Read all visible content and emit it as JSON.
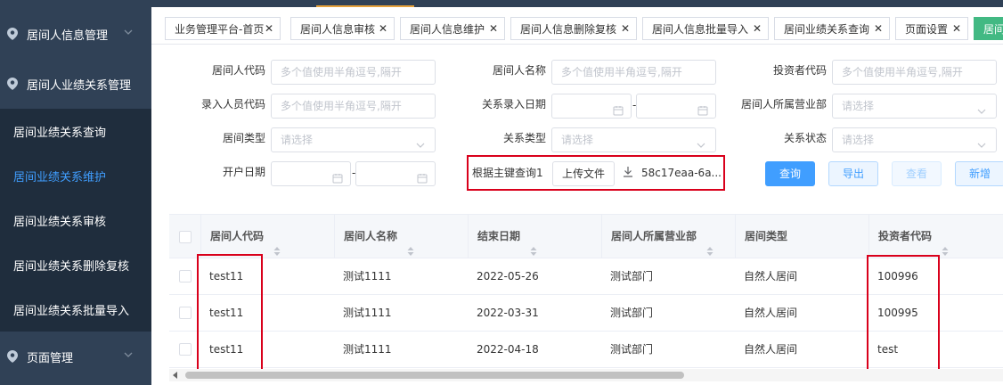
{
  "sidebar": {
    "groups": [
      {
        "label": "居间人信息管理"
      },
      {
        "label": "居间人业绩关系管理"
      },
      {
        "label": "页面管理"
      }
    ],
    "items": [
      {
        "label": "居间业绩关系查询"
      },
      {
        "label": "居间业绩关系维护"
      },
      {
        "label": "居间业绩关系审核"
      },
      {
        "label": "居间业绩关系删除复核"
      },
      {
        "label": "居间业绩关系批量导入"
      }
    ]
  },
  "tabs": [
    {
      "label": "业务管理平台-首页"
    },
    {
      "label": "居间人信息审核"
    },
    {
      "label": "居间人信息维护"
    },
    {
      "label": "居间人信息删除复核"
    },
    {
      "label": "居间人信息批量导入"
    },
    {
      "label": "居间业绩关系查询"
    },
    {
      "label": "页面设置"
    },
    {
      "label": "居间"
    }
  ],
  "form": {
    "broker_code_label": "居间人代码",
    "broker_code_placeholder": "多个值使用半角逗号,隔开",
    "broker_name_label": "居间人名称",
    "broker_name_placeholder": "多个值使用半角逗号,隔开",
    "investor_code_label": "投资者代码",
    "investor_code_placeholder": "多个值使用半角逗号,隔开",
    "entry_code_label": "录入人员代码",
    "entry_code_placeholder": "多个值使用半角逗号,隔开",
    "relation_date_label": "关系录入日期",
    "branch_label": "居间人所属营业部",
    "branch_placeholder": "请选择",
    "broker_type_label": "居间类型",
    "broker_type_placeholder": "请选择",
    "relation_type_label": "关系类型",
    "relation_type_placeholder": "请选择",
    "relation_status_label": "关系状态",
    "relation_status_placeholder": "请选择",
    "open_date_label": "开户日期",
    "pk_query_label": "根据主键查询1",
    "upload_label": "上传文件",
    "file_name": "58c17eaa-6a...",
    "date_sep": "-"
  },
  "buttons": {
    "query": "查询",
    "export": "导出",
    "view": "查看",
    "add": "新增"
  },
  "table": {
    "columns": [
      "居间人代码",
      "居间人名称",
      "结束日期",
      "居间人所属营业部",
      "居间类型",
      "投资者代码"
    ],
    "rows": [
      [
        "test11",
        "测试1111",
        "2022-05-26",
        "测试部门",
        "自然人居间",
        "100996"
      ],
      [
        "test11",
        "测试1111",
        "2022-03-31",
        "测试部门",
        "自然人居间",
        "100995"
      ],
      [
        "test11",
        "测试1111",
        "2022-04-18",
        "测试部门",
        "自然人居间",
        "test"
      ]
    ]
  },
  "colors": {
    "sidebar_bg": "#304156",
    "active_item": "#409eff",
    "active_tab": "#42b983",
    "highlight_box": "#d9001b"
  },
  "icons": [
    "location-pin-icon",
    "chevron-down-icon",
    "close-icon",
    "calendar-icon",
    "download-icon",
    "sort-icon",
    "checkbox-icon"
  ]
}
